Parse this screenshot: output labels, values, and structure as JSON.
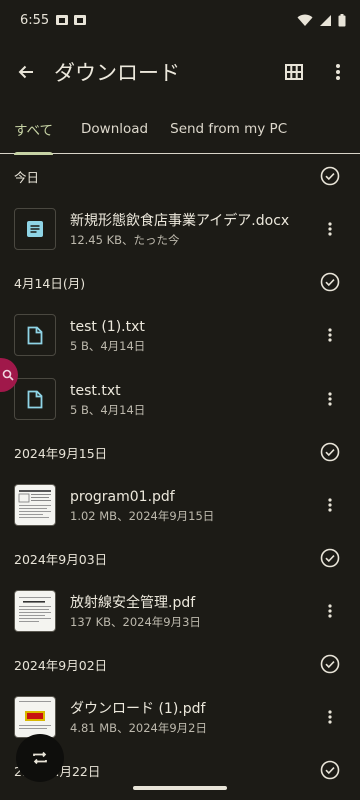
{
  "status": {
    "time": "6:55"
  },
  "app_bar": {
    "title": "ダウンロード"
  },
  "tabs": [
    {
      "label": "すべて",
      "active": true
    },
    {
      "label": "Download",
      "active": false
    },
    {
      "label": "Send from my PC",
      "active": false
    }
  ],
  "sections": [
    {
      "header": "今日",
      "files": [
        {
          "name": "新規形態飲食店事業アイデア.docx",
          "meta": "12.45 KB、たった今",
          "icon": "doc-icon"
        }
      ]
    },
    {
      "header": "4月14日(月)",
      "files": [
        {
          "name": "test (1).txt",
          "meta": "5 B、4月14日",
          "icon": "file-icon"
        },
        {
          "name": "test.txt",
          "meta": "5 B、4月14日",
          "icon": "file-icon"
        }
      ]
    },
    {
      "header": "2024年9月15日",
      "files": [
        {
          "name": "program01.pdf",
          "meta": "1.02 MB、2024年9月15日",
          "icon": "pdf-thumbnail"
        }
      ]
    },
    {
      "header": "2024年9月03日",
      "files": [
        {
          "name": "放射線安全管理.pdf",
          "meta": "137 KB、2024年9月3日",
          "icon": "pdf-thumbnail"
        }
      ]
    },
    {
      "header": "2024年9月02日",
      "files": [
        {
          "name": "ダウンロード (1).pdf",
          "meta": "4.81 MB、2024年9月2日",
          "icon": "pdf-thumbnail"
        }
      ]
    },
    {
      "header": "2…年…月22日",
      "files": []
    }
  ],
  "colors": {
    "background": "#1c1b16",
    "accent": "#c7d3a5",
    "file_icon": "#8fd4e6",
    "side_fab": "#a0184a"
  }
}
